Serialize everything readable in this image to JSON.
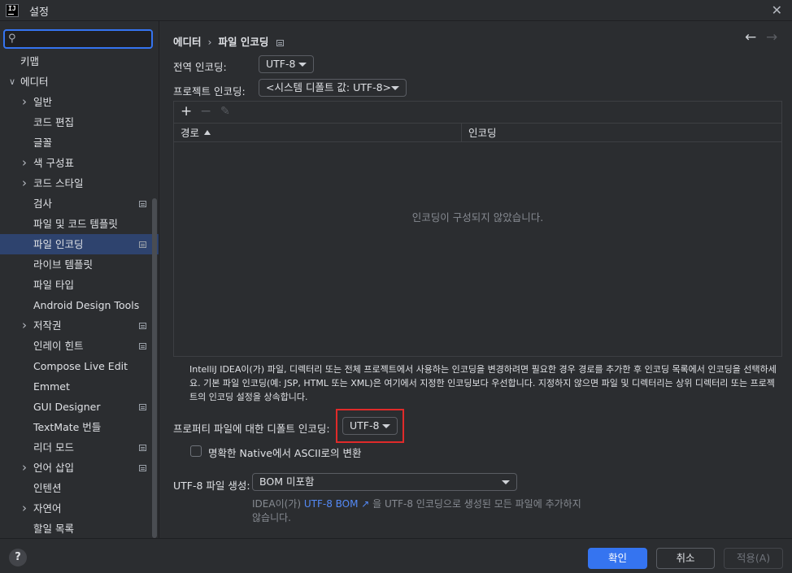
{
  "window": {
    "title": "설정",
    "logo_text": "IJ"
  },
  "search": {
    "value": "",
    "placeholder": ""
  },
  "sidebar": {
    "items": [
      {
        "label": "키맵",
        "indent": 0,
        "chevron": "",
        "mod": false,
        "selected": false
      },
      {
        "label": "에디터",
        "indent": 0,
        "chevron": "down",
        "mod": false,
        "selected": false
      },
      {
        "label": "일반",
        "indent": 1,
        "chevron": "right",
        "mod": false,
        "selected": false
      },
      {
        "label": "코드 편집",
        "indent": 1,
        "chevron": "",
        "mod": false,
        "selected": false
      },
      {
        "label": "글꼴",
        "indent": 1,
        "chevron": "",
        "mod": false,
        "selected": false
      },
      {
        "label": "색 구성표",
        "indent": 1,
        "chevron": "right",
        "mod": false,
        "selected": false
      },
      {
        "label": "코드 스타일",
        "indent": 1,
        "chevron": "right",
        "mod": false,
        "selected": false
      },
      {
        "label": "검사",
        "indent": 1,
        "chevron": "",
        "mod": true,
        "selected": false
      },
      {
        "label": "파일 및 코드 템플릿",
        "indent": 1,
        "chevron": "",
        "mod": false,
        "selected": false
      },
      {
        "label": "파일 인코딩",
        "indent": 1,
        "chevron": "",
        "mod": true,
        "selected": true
      },
      {
        "label": "라이브 템플릿",
        "indent": 1,
        "chevron": "",
        "mod": false,
        "selected": false
      },
      {
        "label": "파일 타입",
        "indent": 1,
        "chevron": "",
        "mod": false,
        "selected": false
      },
      {
        "label": "Android Design Tools",
        "indent": 1,
        "chevron": "",
        "mod": false,
        "selected": false
      },
      {
        "label": "저작권",
        "indent": 1,
        "chevron": "right",
        "mod": true,
        "selected": false
      },
      {
        "label": "인레이 힌트",
        "indent": 1,
        "chevron": "",
        "mod": true,
        "selected": false
      },
      {
        "label": "Compose Live Edit",
        "indent": 1,
        "chevron": "",
        "mod": false,
        "selected": false
      },
      {
        "label": "Emmet",
        "indent": 1,
        "chevron": "",
        "mod": false,
        "selected": false
      },
      {
        "label": "GUI Designer",
        "indent": 1,
        "chevron": "",
        "mod": true,
        "selected": false
      },
      {
        "label": "TextMate 번들",
        "indent": 1,
        "chevron": "",
        "mod": false,
        "selected": false
      },
      {
        "label": "리더 모드",
        "indent": 1,
        "chevron": "",
        "mod": true,
        "selected": false
      },
      {
        "label": "언어 삽입",
        "indent": 1,
        "chevron": "right",
        "mod": true,
        "selected": false
      },
      {
        "label": "인텐션",
        "indent": 1,
        "chevron": "",
        "mod": false,
        "selected": false
      },
      {
        "label": "자연어",
        "indent": 1,
        "chevron": "right",
        "mod": false,
        "selected": false
      },
      {
        "label": "할일 목록",
        "indent": 1,
        "chevron": "",
        "mod": false,
        "selected": false
      }
    ]
  },
  "main": {
    "breadcrumb": {
      "parent": "에디터",
      "separator": "›",
      "current": "파일 인코딩"
    },
    "nav": {
      "back": "←",
      "forward": "→"
    },
    "global_encoding": {
      "label": "전역 인코딩:",
      "value": "UTF-8"
    },
    "project_encoding": {
      "label": "프로젝트 인코딩:",
      "value": "<시스템 디폴트 값: UTF-8>"
    },
    "table": {
      "toolbar": {
        "add": "+",
        "remove": "−",
        "edit": "✎"
      },
      "columns": [
        "경로",
        "인코딩"
      ],
      "empty_text": "인코딩이 구성되지 않았습니다."
    },
    "description": "IntelliJ IDEA이(가) 파일, 디렉터리 또는 전체 프로젝트에서 사용하는 인코딩을 변경하려면 필요한 경우 경로를 추가한 후 인코딩 목록에서 인코딩을 선택하세요. 기본 파일 인코딩(예: JSP, HTML 또는 XML)은 여기에서 지정한 인코딩보다 우선합니다. 지정하지 않으면 파일 및 디렉터리는 상위 디렉터리 또는 프로젝트의 인코딩 설정을 상속합니다.",
    "properties_encoding": {
      "label": "프로퍼티 파일에 대한 디폴트 인코딩:",
      "value": "UTF-8"
    },
    "native_to_ascii": {
      "label": "명확한 Native에서 ASCII로의 변환",
      "checked": false
    },
    "bom": {
      "label": "UTF-8 파일 생성:",
      "value": "BOM 미포함"
    },
    "bom_hint": {
      "prefix": "IDEA이(가) ",
      "link": "UTF-8 BOM ↗",
      "suffix": " 을 UTF-8 인코딩으로 생성된 모든 파일에 추가하지 않습니다."
    }
  },
  "footer": {
    "help": "?",
    "ok": "확인",
    "cancel": "취소",
    "apply": "적용(A)"
  },
  "colors": {
    "accent": "#3574f0",
    "selection": "#2e436e",
    "highlight_border": "#e02a2a",
    "link": "#548af7"
  }
}
